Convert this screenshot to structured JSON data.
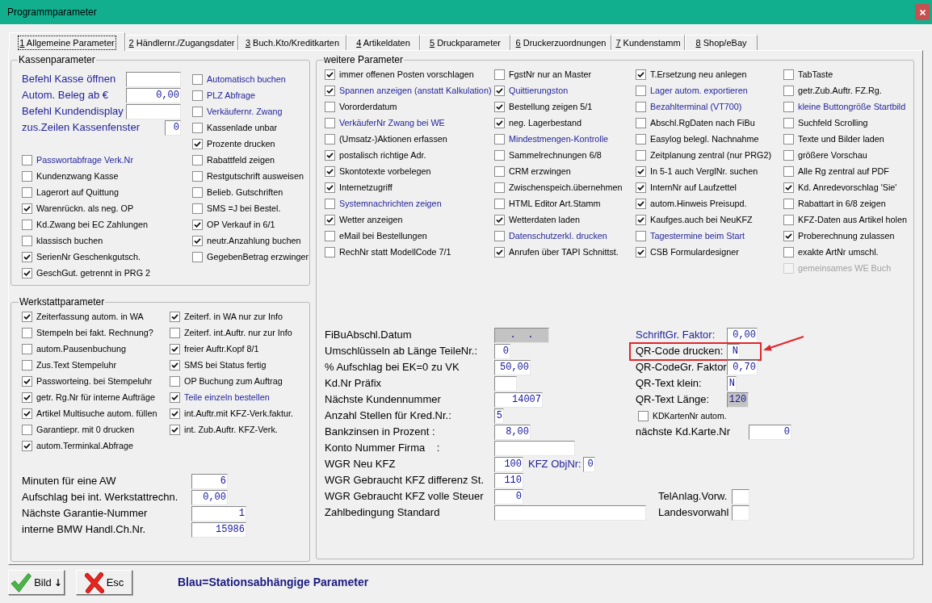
{
  "window": {
    "title": "Programmparameter"
  },
  "tabs": [
    {
      "label": "1 Allgemeine Parameter",
      "selected": true
    },
    {
      "label": "2 Händlernr./Zugangsdater",
      "selected": false
    },
    {
      "label": "3 Buch.Kto/Kreditkarten",
      "selected": false
    },
    {
      "label": "4 Artikeldaten",
      "selected": false
    },
    {
      "label": "5 Druckparameter",
      "selected": false
    },
    {
      "label": "6 Druckerzuordnungen",
      "selected": false
    },
    {
      "label": "7 Kundenstamm",
      "selected": false
    },
    {
      "label": "8 Shop/eBay",
      "selected": false
    }
  ],
  "kassenparameter": {
    "title": "Kassenparameter",
    "fields": [
      {
        "label": "Befehl Kasse öffnen",
        "station": true
      },
      {
        "label": "Autom. Beleg ab €",
        "value": "0,00",
        "station": true
      },
      {
        "label": "Befehl Kundendisplay",
        "station": true
      },
      {
        "label": "zus.Zeilen Kassenfenster",
        "value": "0",
        "station": true
      }
    ],
    "checks_left": [
      {
        "label": "Passwortabfrage Verk.Nr",
        "checked": false,
        "station": true
      },
      {
        "label": "Kundenzwang Kasse",
        "checked": false,
        "station": false
      },
      {
        "label": "Lagerort auf Quittung",
        "checked": false,
        "station": false
      },
      {
        "label": "Warenrückn. als neg. OP",
        "checked": true,
        "station": false
      },
      {
        "label": "Kd.Zwang bei EC Zahlungen",
        "checked": false,
        "station": false
      },
      {
        "label": "klassisch buchen",
        "checked": false,
        "station": false
      },
      {
        "label": "SerienNr Geschenkgutsch.",
        "checked": true,
        "station": false
      },
      {
        "label": "GeschGut. getrennt in PRG 2",
        "checked": true,
        "station": false
      }
    ],
    "checks_right": [
      {
        "label": "Automatisch buchen",
        "checked": false,
        "station": true
      },
      {
        "label": "PLZ Abfrage",
        "checked": false,
        "station": true
      },
      {
        "label": "Verkäufernr. Zwang",
        "checked": false,
        "station": true
      },
      {
        "label": "Kassenlade unbar",
        "checked": false,
        "station": false
      },
      {
        "label": "Prozente drucken",
        "checked": true,
        "station": false
      },
      {
        "label": "Rabattfeld zeigen",
        "checked": false,
        "station": false
      },
      {
        "label": "Restgutschrift ausweisen",
        "checked": false,
        "station": false
      },
      {
        "label": "Belieb. Gutschriften",
        "checked": false,
        "station": false
      },
      {
        "label": "SMS =J bei Bestel.",
        "checked": false,
        "station": false
      },
      {
        "label": "OP Verkauf in 6/1",
        "checked": true,
        "station": false
      },
      {
        "label": "neutr.Anzahlung buchen",
        "checked": true,
        "station": false
      },
      {
        "label": "GegebenBetrag erzwinger",
        "checked": false,
        "station": false
      }
    ]
  },
  "werkstattparameter": {
    "title": "Werkstattparameter",
    "checks_left": [
      {
        "label": "Zeiterfassung autom. in WA",
        "checked": true,
        "station": false
      },
      {
        "label": "Stempeln bei fakt. Rechnung?",
        "checked": false,
        "station": false
      },
      {
        "label": "autom.Pausenbuchung",
        "checked": false,
        "station": false
      },
      {
        "label": "Zus.Text Stempeluhr",
        "checked": false,
        "station": false
      },
      {
        "label": "Passworteing. bei Stempeluhr",
        "checked": true,
        "station": false
      },
      {
        "label": "getr. Rg.Nr für interne Aufträge",
        "checked": true,
        "station": false
      },
      {
        "label": "Artikel Multisuche autom. füllen",
        "checked": true,
        "station": false
      },
      {
        "label": "Garantiepr. mit 0 drucken",
        "checked": false,
        "station": false
      },
      {
        "label": "autom.Terminkal.Abfrage",
        "checked": true,
        "station": false
      }
    ],
    "checks_right": [
      {
        "label": "Zeiterf. in WA nur zur Info",
        "checked": true,
        "station": false
      },
      {
        "label": "Zeiterf. int.Auftr. nur zur Info",
        "checked": false,
        "station": false
      },
      {
        "label": "freier Auftr.Kopf 8/1",
        "checked": true,
        "station": false
      },
      {
        "label": "SMS bei Status fertig",
        "checked": true,
        "station": false
      },
      {
        "label": "OP Buchung zum Auftrag",
        "checked": false,
        "station": false
      },
      {
        "label": "Teile einzeln bestellen",
        "checked": true,
        "station": true
      },
      {
        "label": "int.Auftr.mit KFZ-Verk.faktur.",
        "checked": true,
        "station": false
      },
      {
        "label": "int. Zub.Auftr. KFZ-Verk.",
        "checked": true,
        "station": false
      }
    ],
    "fields": [
      {
        "label": "Minuten für eine AW",
        "value": "6",
        "station": false
      },
      {
        "label": "Aufschlag bei int. Werkstattrechn.",
        "value": "0,00",
        "station": false
      },
      {
        "label": "Nächste Garantie-Nummer",
        "value": "1",
        "station": false
      },
      {
        "label": "interne BMW Handl.Ch.Nr.",
        "value": "15986",
        "station": false
      }
    ]
  },
  "weitere_parameter": {
    "title": "weitere Parameter",
    "check_columns": [
      {
        "items": [
          {
            "label": "immer offenen Posten vorschlagen",
            "checked": true,
            "station": false
          },
          {
            "label": "Spannen anzeigen (anstatt Kalkulation)",
            "checked": true,
            "station": true
          },
          {
            "label": "Vororderdatum",
            "checked": false,
            "station": false
          },
          {
            "label": "VerkäuferNr Zwang bei WE",
            "checked": false,
            "station": true
          },
          {
            "label": "(Umsatz-)Aktionen erfassen",
            "checked": false,
            "station": false
          },
          {
            "label": "postalisch richtige Adr.",
            "checked": true,
            "station": false
          },
          {
            "label": "Skontotexte vorbelegen",
            "checked": true,
            "station": false
          },
          {
            "label": "Internetzugriff",
            "checked": true,
            "station": false
          },
          {
            "label": "Systemnachrichten zeigen",
            "checked": false,
            "station": true
          },
          {
            "label": "Wetter anzeigen",
            "checked": true,
            "station": false
          },
          {
            "label": "eMail bei Bestellungen",
            "checked": false,
            "station": false
          },
          {
            "label": "RechNr statt ModellCode 7/1",
            "checked": false,
            "station": false
          }
        ]
      },
      {
        "items": [
          {
            "label": "FgstNr nur an Master",
            "checked": false,
            "station": false
          },
          {
            "label": "Quittierungston",
            "checked": true,
            "station": true
          },
          {
            "label": "Bestellung zeigen 5/1",
            "checked": true,
            "station": false
          },
          {
            "label": "neg. Lagerbestand",
            "checked": true,
            "station": false
          },
          {
            "label": "Mindestmengen-Kontrolle",
            "checked": false,
            "station": true
          },
          {
            "label": "Sammelrechnungen 6/8",
            "checked": false,
            "station": false
          },
          {
            "label": "CRM erzwingen",
            "checked": false,
            "station": false
          },
          {
            "label": "Zwischenspeich.übernehmen",
            "checked": false,
            "station": false
          },
          {
            "label": "HTML Editor Art.Stamm",
            "checked": false,
            "station": false
          },
          {
            "label": "Wetterdaten laden",
            "checked": true,
            "station": false
          },
          {
            "label": "Datenschutzerkl. drucken",
            "checked": false,
            "station": true
          },
          {
            "label": "Anrufen über TAPI Schnittst.",
            "checked": true,
            "station": false
          }
        ]
      },
      {
        "items": [
          {
            "label": "T.Ersetzung neu anlegen",
            "checked": true,
            "station": false
          },
          {
            "label": "Lager autom. exportieren",
            "checked": false,
            "station": true
          },
          {
            "label": "Bezahlterminal (VT700)",
            "checked": false,
            "station": true
          },
          {
            "label": "Abschl.RgDaten nach FiBu",
            "checked": false,
            "station": false
          },
          {
            "label": "Easylog belegl. Nachnahme",
            "checked": false,
            "station": false
          },
          {
            "label": "Zeitplanung zentral (nur PRG2)",
            "checked": false,
            "station": false
          },
          {
            "label": "In 5-1 auch VerglNr. suchen",
            "checked": true,
            "station": false
          },
          {
            "label": "InternNr auf Laufzettel",
            "checked": true,
            "station": false
          },
          {
            "label": "autom.Hinweis Preisupd.",
            "checked": true,
            "station": false
          },
          {
            "label": "Kaufges.auch bei NeuKFZ",
            "checked": true,
            "station": false
          },
          {
            "label": "Tagestermine beim Start",
            "checked": false,
            "station": true
          },
          {
            "label": "CSB Formulardesigner",
            "checked": true,
            "station": false
          }
        ]
      },
      {
        "items": [
          {
            "label": "TabTaste",
            "checked": false,
            "station": false,
            "disabled": false
          },
          {
            "label": "getr.Zub.Auftr. FZ.Rg.",
            "checked": false,
            "station": false,
            "disabled": false
          },
          {
            "label": "kleine Buttongröße Startbild",
            "checked": false,
            "station": true,
            "disabled": false
          },
          {
            "label": "Suchfeld Scrolling",
            "checked": false,
            "station": false,
            "disabled": false
          },
          {
            "label": "Texte und Bilder laden",
            "checked": false,
            "station": false,
            "disabled": false
          },
          {
            "label": "größere Vorschau",
            "checked": false,
            "station": false,
            "disabled": false
          },
          {
            "label": "Alle Rg zentral auf PDF",
            "checked": false,
            "station": false,
            "disabled": false
          },
          {
            "label": "Kd. Anredevorschlag 'Sie'",
            "checked": true,
            "station": false,
            "disabled": false
          },
          {
            "label": "Rabattart in 6/8 zeigen",
            "checked": false,
            "station": false,
            "disabled": false
          },
          {
            "label": "KFZ-Daten aus Artikel holen",
            "checked": false,
            "station": false,
            "disabled": false
          },
          {
            "label": "Proberechnung zulassen",
            "checked": true,
            "station": false,
            "disabled": false
          },
          {
            "label": "exakte ArtNr umschl.",
            "checked": false,
            "station": false,
            "disabled": false
          },
          {
            "label": "gemeinsames WE Buch",
            "checked": false,
            "station": false,
            "disabled": true
          }
        ]
      }
    ],
    "fields_left": [
      {
        "label": "FiBuAbschl.Datum",
        "value": ".  .",
        "disabled": true,
        "station": false
      },
      {
        "label": "Umschlüsseln ab Länge TeileNr.:",
        "value": "0",
        "disabled": false,
        "station": false
      },
      {
        "label": "% Aufschlag bei EK=0 zu VK",
        "value": "50,00",
        "disabled": false,
        "station": false
      },
      {
        "label": "Kd.Nr Präfix",
        "disabled": false,
        "station": false
      },
      {
        "label": "Nächste Kundennummer",
        "value": "14007",
        "disabled": false,
        "station": false
      },
      {
        "label": "Anzahl Stellen für Kred.Nr.:",
        "value": "5",
        "disabled": false,
        "station": false
      },
      {
        "label": "Bankzinsen in Prozent :",
        "value": "8,00",
        "disabled": false,
        "station": false
      },
      {
        "label": "Konto Nummer Firma    :",
        "disabled": false,
        "station": false
      },
      {
        "label": "WGR Neu KFZ",
        "value": "100",
        "disabled": false,
        "station": false,
        "extra": {
          "label": "KFZ ObjNr:",
          "value": "0",
          "station": true
        }
      },
      {
        "label": "WGR Gebraucht KFZ differenz St.",
        "value": "110",
        "disabled": false,
        "station": false
      },
      {
        "label": "WGR Gebraucht KFZ volle Steuer",
        "value": "0",
        "disabled": false,
        "station": false
      },
      {
        "label": "Zahlbedingung Standard",
        "disabled": false,
        "station": false
      }
    ],
    "fields_right": [
      {
        "label": "SchriftGr. Faktor:",
        "value": "0,00",
        "station": true,
        "disabled": false,
        "highlighted": false
      },
      {
        "label": "QR-Code drucken:",
        "value": "N",
        "station": false,
        "disabled": false,
        "highlighted": true
      },
      {
        "label": "QR-CodeGr. Faktor",
        "value": "0,70",
        "station": false,
        "disabled": false,
        "highlighted": false
      },
      {
        "label": "QR-Text klein:",
        "value": "N",
        "station": false,
        "disabled": false,
        "highlighted": false
      },
      {
        "label": "QR-Text Länge:",
        "value": "120",
        "station": false,
        "disabled": true,
        "highlighted": false
      }
    ],
    "card_check": {
      "label": "KDKartenNr autom.",
      "checked": false
    },
    "card_number": {
      "label": "nächste Kd.Karte.Nr",
      "value": "0"
    },
    "phone_fields": [
      {
        "label": "TelAnlag.Vorw."
      },
      {
        "label": "Landesvorwahl"
      }
    ]
  },
  "buttons": [
    {
      "label": "Bild",
      "arrow": "↓",
      "kind": "confirm"
    },
    {
      "label": "Esc",
      "kind": "cancel"
    }
  ],
  "legend_note": "Blau=Stationsabhängige Parameter"
}
